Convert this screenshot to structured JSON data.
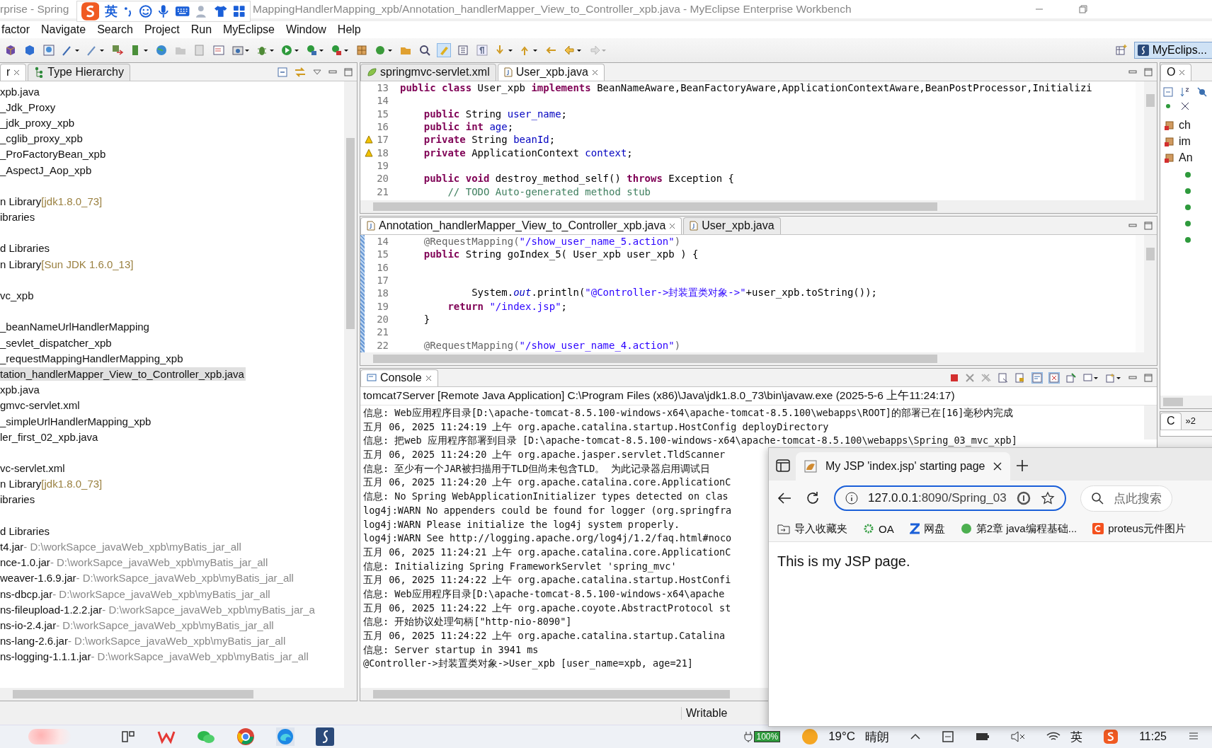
{
  "window": {
    "title_left": "rprise - Spring",
    "title_right": "MappingHandlerMapping_xpb/Annotation_handlerMapper_View_to_Controller_xpb.java - MyEclipse Enterprise Workbench"
  },
  "ime_bar": {
    "label": "英"
  },
  "menu": [
    "factor",
    "Navigate",
    "Search",
    "Project",
    "Run",
    "MyEclipse",
    "Window",
    "Help"
  ],
  "perspective": {
    "label": "MyEclips...",
    "selected": true
  },
  "explorer": {
    "tabs": [
      {
        "label": "r",
        "selected": true
      },
      {
        "label": "Type Hierarchy",
        "selected": false
      }
    ],
    "groups": [
      {
        "items": [
          {
            "label": "xpb.java",
            "selected": false
          },
          {
            "label": "_Jdk_Proxy",
            "selected": false
          },
          {
            "label": "_jdk_proxy_xpb",
            "selected": false
          },
          {
            "label": "_cglib_proxy_xpb",
            "selected": false
          },
          {
            "label": "_ProFactoryBean_xpb",
            "selected": false
          },
          {
            "label": "_AspectJ_Aop_xpb",
            "selected": false
          }
        ]
      },
      {
        "items": [
          {
            "label": "n Library",
            "suffix": "[jdk1.8.0_73]",
            "selected": false
          },
          {
            "label": "ibraries",
            "selected": false
          }
        ]
      },
      {
        "items": [
          {
            "label": "d Libraries",
            "selected": false
          },
          {
            "label": "n Library",
            "suffix": "[Sun JDK 1.6.0_13]",
            "selected": false
          }
        ]
      },
      {
        "items": [
          {
            "label": "vc_xpb",
            "selected": false
          }
        ]
      },
      {
        "items": [
          {
            "label": "_beanNameUrlHandlerMapping",
            "selected": false
          },
          {
            "label": "_sevlet_dispatcher_xpb",
            "selected": false
          },
          {
            "label": "_requestMappingHandlerMapping_xpb",
            "selected": false
          },
          {
            "label": "tation_handlerMapper_View_to_Controller_xpb.java",
            "selected": true
          },
          {
            "label": "xpb.java",
            "selected": false
          },
          {
            "label": "gmvc-servlet.xml",
            "selected": false
          },
          {
            "label": "_simpleUrlHandlerMapping_xpb",
            "selected": false
          },
          {
            "label": "ler_first_02_xpb.java",
            "selected": false
          }
        ]
      },
      {
        "items": [
          {
            "label": "vc-servlet.xml",
            "selected": false
          },
          {
            "label": "n Library",
            "suffix": "[jdk1.8.0_73]",
            "selected": false
          },
          {
            "label": "ibraries",
            "selected": false
          }
        ]
      },
      {
        "items": [
          {
            "label": "d Libraries",
            "selected": false
          },
          {
            "label": "t4.jar",
            "suffix": "- D:\\workSapce_javaWeb_xpb\\myBatis_jar_all",
            "selected": false
          },
          {
            "label": "nce-1.0.jar",
            "suffix": "- D:\\workSapce_javaWeb_xpb\\myBatis_jar_all",
            "selected": false
          },
          {
            "label": "weaver-1.6.9.jar",
            "suffix": "- D:\\workSapce_javaWeb_xpb\\myBatis_jar_all",
            "selected": false
          },
          {
            "label": "ns-dbcp.jar",
            "suffix": "- D:\\workSapce_javaWeb_xpb\\myBatis_jar_all",
            "selected": false
          },
          {
            "label": "ns-fileupload-1.2.2.jar",
            "suffix": "- D:\\workSapce_javaWeb_xpb\\myBatis_jar_a",
            "selected": false
          },
          {
            "label": "ns-io-2.4.jar",
            "suffix": "- D:\\workSapce_javaWeb_xpb\\myBatis_jar_all",
            "selected": false
          },
          {
            "label": "ns-lang-2.6.jar",
            "suffix": "- D:\\workSapce_javaWeb_xpb\\myBatis_jar_all",
            "selected": false
          },
          {
            "label": "ns-logging-1.1.1.jar",
            "suffix": "- D:\\workSapce_javaWeb_xpb\\myBatis_jar_all",
            "selected": false
          }
        ]
      }
    ]
  },
  "editors": [
    {
      "tabs": [
        {
          "label": "springmvc-servlet.xml",
          "kind": "xml",
          "selected": false
        },
        {
          "label": "User_xpb.java",
          "kind": "java",
          "selected": true
        }
      ],
      "lines": [
        {
          "number": "13",
          "warning": false,
          "segments": [
            {
              "kind": "kw",
              "t": "public class "
            },
            {
              "kind": "plain",
              "t": "User_xpb "
            },
            {
              "kind": "kw",
              "t": "implements "
            },
            {
              "kind": "plain",
              "t": "BeanNameAware,BeanFactoryAware,ApplicationContextAware,BeanPostProcessor,Initializi"
            }
          ]
        },
        {
          "number": "14",
          "warning": false
        },
        {
          "number": "15",
          "warning": false,
          "segments": [
            {
              "kind": "kw",
              "t": "    public "
            },
            {
              "kind": "plain",
              "t": "String "
            },
            {
              "kind": "field",
              "t": "user_name"
            },
            {
              "kind": "plain",
              "t": ";"
            }
          ]
        },
        {
          "number": "16",
          "warning": false,
          "segments": [
            {
              "kind": "kw",
              "t": "    public int "
            },
            {
              "kind": "field",
              "t": "age"
            },
            {
              "kind": "plain",
              "t": ";"
            }
          ]
        },
        {
          "number": "17",
          "warning": true,
          "segments": [
            {
              "kind": "kw",
              "t": "    private "
            },
            {
              "kind": "plain",
              "t": "String "
            },
            {
              "kind": "field",
              "t": "beanId"
            },
            {
              "kind": "plain",
              "t": ";"
            }
          ]
        },
        {
          "number": "18",
          "warning": true,
          "segments": [
            {
              "kind": "kw",
              "t": "    private "
            },
            {
              "kind": "plain",
              "t": "ApplicationContext "
            },
            {
              "kind": "field",
              "t": "context"
            },
            {
              "kind": "plain",
              "t": ";"
            }
          ]
        },
        {
          "number": "19",
          "warning": false
        },
        {
          "number": "20",
          "warning": false,
          "segments": [
            {
              "kind": "kw",
              "t": "    public void "
            },
            {
              "kind": "plain",
              "t": "destroy_method_self() "
            },
            {
              "kind": "kw",
              "t": "throws "
            },
            {
              "kind": "plain",
              "t": "Exception {"
            }
          ]
        },
        {
          "number": "21",
          "warning": false,
          "segments": [
            {
              "kind": "comment",
              "t": "        // TODO Auto-generated method stub"
            }
          ]
        }
      ]
    },
    {
      "tabs": [
        {
          "label": "Annotation_handlerMapper_View_to_Controller_xpb.java",
          "kind": "java",
          "selected": true
        },
        {
          "label": "User_xpb.java",
          "kind": "java",
          "selected": false
        }
      ],
      "lines": [
        {
          "number": "14",
          "warning": false,
          "segments": [
            {
              "kind": "ann",
              "t": "    @RequestMapping("
            },
            {
              "kind": "str",
              "t": "\"/show_user_name_5.action\""
            },
            {
              "kind": "ann",
              "t": ")"
            }
          ]
        },
        {
          "number": "15",
          "warning": false,
          "segments": [
            {
              "kind": "kw",
              "t": "    public "
            },
            {
              "kind": "plain",
              "t": "String goIndex_5( User_xpb user_xpb ) {"
            }
          ]
        },
        {
          "number": "16",
          "warning": false
        },
        {
          "number": "17",
          "warning": false
        },
        {
          "number": "18",
          "warning": false,
          "segments": [
            {
              "kind": "plain",
              "t": "            System."
            },
            {
              "kind": "static",
              "t": "out"
            },
            {
              "kind": "plain",
              "t": ".println("
            },
            {
              "kind": "str",
              "t": "\"@Controller->封装置类对象->\""
            },
            {
              "kind": "plain",
              "t": "+user_xpb.toString());"
            }
          ]
        },
        {
          "number": "19",
          "warning": false,
          "segments": [
            {
              "kind": "kw",
              "t": "        return "
            },
            {
              "kind": "str",
              "t": "\"/index.jsp\""
            },
            {
              "kind": "plain",
              "t": ";"
            }
          ]
        },
        {
          "number": "20",
          "warning": false,
          "segments": [
            {
              "kind": "plain",
              "t": "    }"
            }
          ]
        },
        {
          "number": "21",
          "warning": false
        },
        {
          "number": "22",
          "warning": false,
          "segments": [
            {
              "kind": "ann",
              "t": "    @RequestMapping("
            },
            {
              "kind": "str",
              "t": "\"/show_user_name_4.action\""
            },
            {
              "kind": "ann",
              "t": ")"
            }
          ]
        }
      ]
    }
  ],
  "outline": {
    "tab": "O",
    "items": [
      {
        "label": "ch"
      },
      {
        "label": "im"
      },
      {
        "label": "An"
      }
    ]
  },
  "mini_panel": {
    "tab": "C",
    "overflow": "»2"
  },
  "console": {
    "tab": "Console",
    "process": "tomcat7Server [Remote Java Application] C:\\Program Files (x86)\\Java\\jdk1.8.0_73\\bin\\javaw.exe (2025-5-6 上午11:24:17)",
    "lines": [
      "信息: Web应用程序目录[D:\\apache-tomcat-8.5.100-windows-x64\\apache-tomcat-8.5.100\\webapps\\ROOT]的部署已在[16]毫秒内完成",
      "五月 06, 2025 11:24:19 上午 org.apache.catalina.startup.HostConfig deployDirectory",
      "信息: 把web 应用程序部署到目录 [D:\\apache-tomcat-8.5.100-windows-x64\\apache-tomcat-8.5.100\\webapps\\Spring_03_mvc_xpb]",
      "五月 06, 2025 11:24:20 上午 org.apache.jasper.servlet.TldScanner",
      "信息: 至少有一个JAR被扫描用于TLD但尚未包含TLD。 为此记录器启用调试日",
      "五月 06, 2025 11:24:20 上午 org.apache.catalina.core.ApplicationC",
      "信息: No Spring WebApplicationInitializer types detected on clas",
      "log4j:WARN No appenders could be found for logger (org.springfra",
      "log4j:WARN Please initialize the log4j system properly.",
      "log4j:WARN See http://logging.apache.org/log4j/1.2/faq.html#noco",
      "五月 06, 2025 11:24:21 上午 org.apache.catalina.core.ApplicationC",
      "信息: Initializing Spring FrameworkServlet 'spring_mvc'",
      "五月 06, 2025 11:24:22 上午 org.apache.catalina.startup.HostConfi",
      "信息: Web应用程序目录[D:\\apache-tomcat-8.5.100-windows-x64\\apache",
      "五月 06, 2025 11:24:22 上午 org.apache.coyote.AbstractProtocol st",
      "信息: 开始协议处理句柄[\"http-nio-8090\"]",
      "五月 06, 2025 11:24:22 上午 org.apache.catalina.startup.Catalina",
      "信息: Server startup in 3941 ms",
      "@Controller->封装置类对象->User_xpb [user_name=xpb, age=21]"
    ]
  },
  "status_bar": {
    "mode": "Writable"
  },
  "browser": {
    "tab": "My JSP 'index.jsp' starting page",
    "url_host": "127.0.0.1",
    "url_path": ":8090/Spring_03",
    "search_placeholder": "点此搜索",
    "bookmarks": [
      {
        "label": "导入收藏夹",
        "kind": "import"
      },
      {
        "label": "OA",
        "kind": "gear"
      },
      {
        "label": "网盘",
        "kind": "z"
      },
      {
        "label": "第2章 java编程基础...",
        "kind": "circle"
      },
      {
        "label": "proteus元件图片",
        "kind": "c"
      }
    ],
    "page_text": "This is my JSP page."
  },
  "taskbar": {
    "battery": "100%",
    "temperature": "19°C",
    "weather": "晴朗",
    "ime": "英",
    "time": "11:25"
  }
}
